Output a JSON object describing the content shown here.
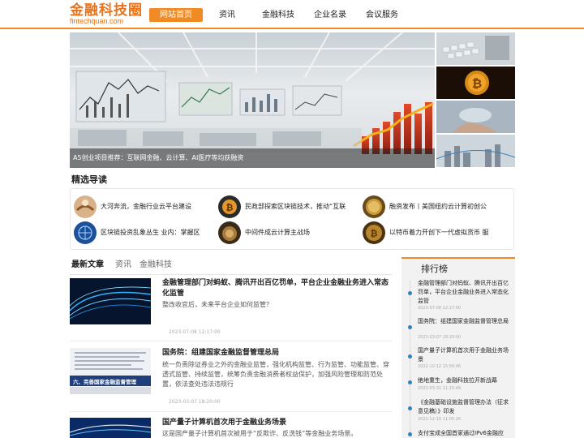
{
  "brand": {
    "name": "金融科技圈",
    "domain": "fintechquan.com",
    "accent": "#f08a24"
  },
  "nav": {
    "items": [
      {
        "label": "网站首页",
        "active": true
      },
      {
        "label": "资讯",
        "active": false
      },
      {
        "label": "金融科技",
        "active": false
      },
      {
        "label": "企业名录",
        "active": false
      },
      {
        "label": "会议服务",
        "active": false
      }
    ]
  },
  "hero": {
    "caption": "A5创业项目推荐：互联网金融、云计算、AI医疗等均获融资"
  },
  "featured": {
    "title": "精选导读",
    "items": [
      {
        "text": "大河奔流，金融行业云平台建设",
        "icon": "handshake-icon"
      },
      {
        "text": "民政部探索区块链技术，推动“互联",
        "icon": "bitcoin-icon"
      },
      {
        "text": "融资发布丨美国纽约云计算初创公",
        "icon": "bitcoin-gold-icon"
      },
      {
        "text": "区块链投资乱象丛生 业内：掌握区",
        "icon": "globe-network-icon"
      },
      {
        "text": "中间件成云计算主战场",
        "icon": "coin-icon"
      },
      {
        "text": "以特币着力开创下一代虚拟货币 服",
        "icon": "bitcoin-coin-icon"
      }
    ]
  },
  "tabs": [
    {
      "label": "最新文章",
      "active": true
    },
    {
      "label": "资讯",
      "active": false
    },
    {
      "label": "金融科技",
      "active": false
    }
  ],
  "articles": [
    {
      "title": "金融管理部门对蚂蚁、腾讯开出百亿罚单，平台企业金融业务进入常态化监管",
      "summary": "整改收官后，未来平台企业如何监管？",
      "date": "2023-07-08 12:17:00"
    },
    {
      "title": "国务院：组建国家金融监督管理总局",
      "summary": "统一负责除证券业之外的金融业监管，强化机构监管、行为监管、功能监管、穿透式监管、持续监管，统筹负责金融消费者权益保护，加强风险管理和防范处置，依法查处违法违规行",
      "image_text": "六、完善国家金融监督管理",
      "date": "2023-03-07 18:20:00"
    },
    {
      "title": "国产量子计算机首次用于金融业务场景",
      "summary": "这是国产量子计算机首次被用于“反欺诈、反洗钱”等金融业务场景。",
      "date": ""
    }
  ],
  "ranking": {
    "title": "排行榜",
    "items": [
      {
        "text": "金融管理部门对蚂蚁、腾讯开出百亿罚单，平台企业金融业务进入常态化监管",
        "date": "2023-07-08 12:17:00"
      },
      {
        "text": "国务院：组建国家金融监督管理总局",
        "date": "2023-03-07 18:20:00"
      },
      {
        "text": "国产量子计算机首次用于金融业务场景",
        "date": "2022-10-12 15:56:46"
      },
      {
        "text": "绝地重生，金融科技拉开新战幕",
        "date": "2022-03-31 11:15:49"
      },
      {
        "text": "《金融基础设施监督管理办法（征求意见稿）》印发",
        "date": "2022-12-16 11:05:26"
      },
      {
        "text": "支付宝成全国首家通过IPv6金融应",
        "date": ""
      }
    ]
  }
}
